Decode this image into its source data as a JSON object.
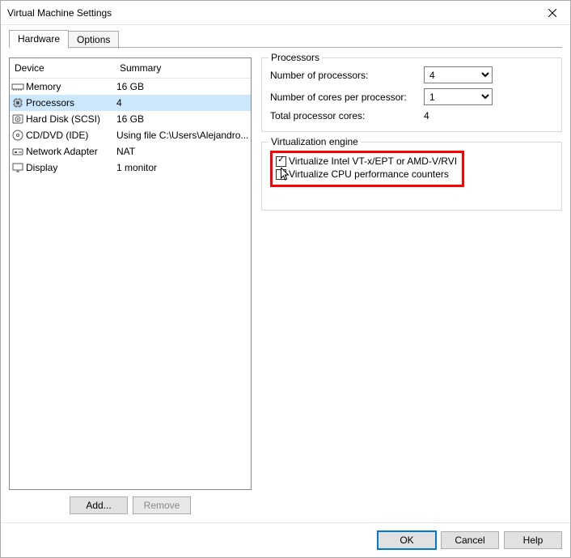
{
  "window": {
    "title": "Virtual Machine Settings"
  },
  "tabs": {
    "hardware": "Hardware",
    "options": "Options"
  },
  "deviceTable": {
    "headers": {
      "device": "Device",
      "summary": "Summary"
    },
    "rows": [
      {
        "icon": "memory",
        "label": "Memory",
        "summary": "16 GB"
      },
      {
        "icon": "cpu",
        "label": "Processors",
        "summary": "4"
      },
      {
        "icon": "disk",
        "label": "Hard Disk (SCSI)",
        "summary": "16 GB"
      },
      {
        "icon": "cd",
        "label": "CD/DVD (IDE)",
        "summary": "Using file C:\\Users\\Alejandro..."
      },
      {
        "icon": "network",
        "label": "Network Adapter",
        "summary": "NAT"
      },
      {
        "icon": "display",
        "label": "Display",
        "summary": "1 monitor"
      }
    ],
    "selectedIndex": 1
  },
  "leftButtons": {
    "add": "Add...",
    "remove": "Remove"
  },
  "processors": {
    "legend": "Processors",
    "numProcessorsLabel": "Number of processors:",
    "numProcessorsValue": "4",
    "coresLabel": "Number of cores per processor:",
    "coresValue": "1",
    "totalLabel": "Total processor cores:",
    "totalValue": "4"
  },
  "virtEngine": {
    "legend": "Virtualization engine",
    "vtx": {
      "checked": true,
      "label": "Virtualize Intel VT-x/EPT or AMD-V/RVI"
    },
    "perf": {
      "checked": false,
      "label": "Virtualize CPU performance counters"
    }
  },
  "footer": {
    "ok": "OK",
    "cancel": "Cancel",
    "help": "Help"
  }
}
